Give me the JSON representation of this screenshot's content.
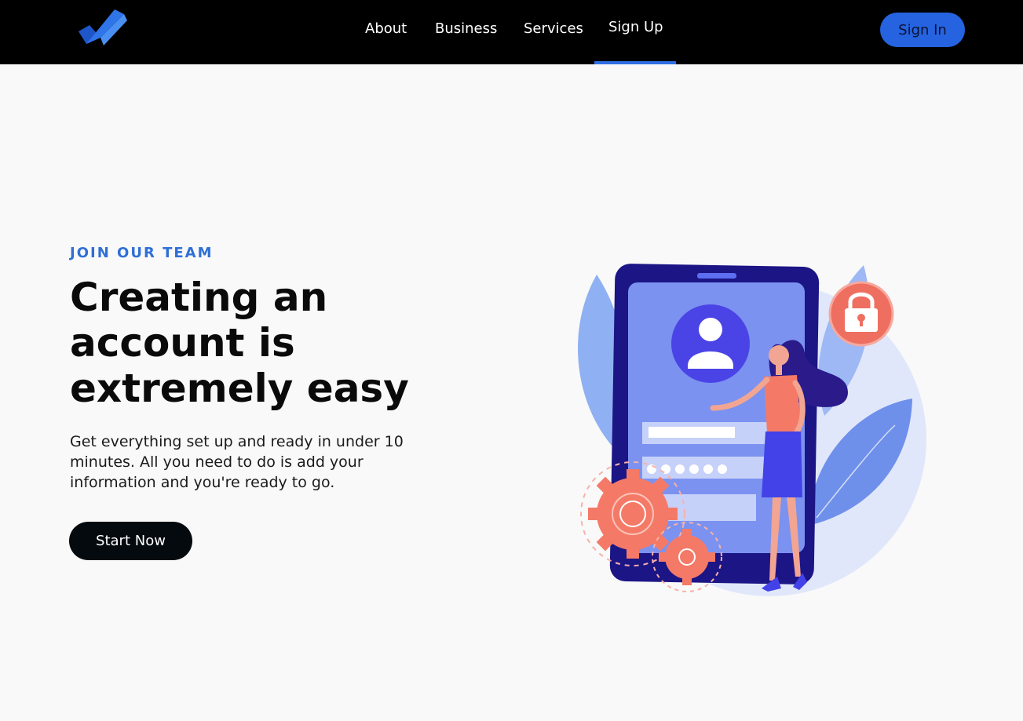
{
  "nav": {
    "links": [
      "About",
      "Business",
      "Services",
      "Sign Up"
    ],
    "active": "Sign Up",
    "signin_label": "Sign In"
  },
  "hero": {
    "eyebrow": "JOIN OUR TEAM",
    "headline": "Creating an account is extremely easy",
    "subtext": "Get everything set up and ready in under 10 minutes. All you need to do is add your information and you're ready to go.",
    "cta_label": "Start Now"
  },
  "colors": {
    "accent": "#2563e0",
    "eyebrow": "#2f6fd6",
    "navbar": "#000000",
    "background": "#f9f9f9"
  },
  "illustration": {
    "icons": [
      "user-avatar-icon",
      "padlock-icon",
      "gear-icon"
    ],
    "password_dots": 6
  }
}
